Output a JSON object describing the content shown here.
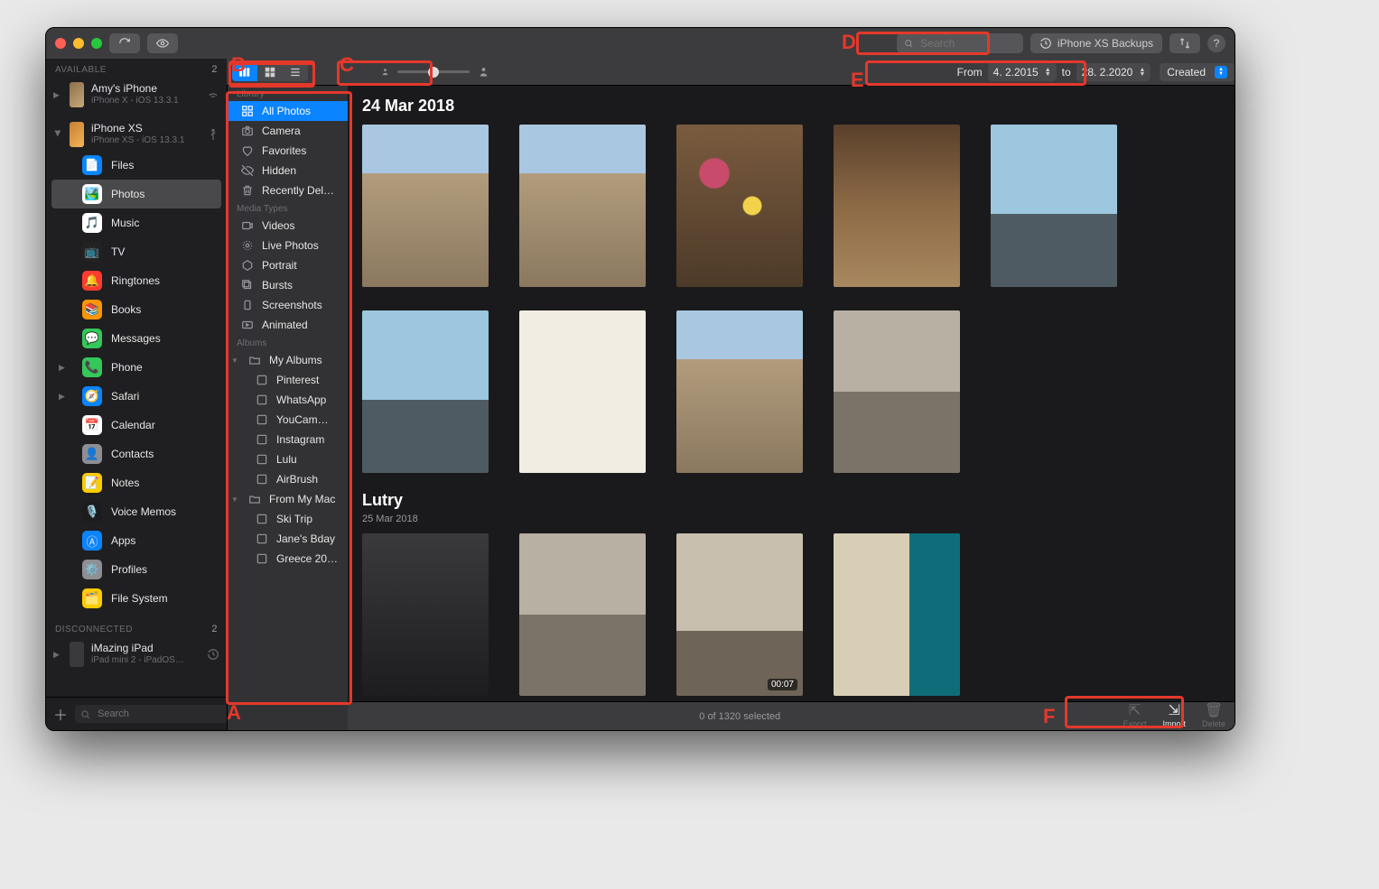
{
  "toolbar": {
    "search_placeholder": "Search",
    "backups_label": "iPhone XS Backups",
    "help_label": "?"
  },
  "sidebar": {
    "sections": {
      "available": {
        "label": "AVAILABLE",
        "count": "2"
      },
      "disconnected": {
        "label": "DISCONNECTED",
        "count": "2"
      }
    },
    "devices": [
      {
        "name": "Amy's iPhone",
        "sub": "iPhone X - iOS 13.3.1",
        "conn": "wifi",
        "expanded": false
      },
      {
        "name": "iPhone XS",
        "sub": "iPhone XS - iOS 13.3.1",
        "conn": "usb",
        "expanded": true
      }
    ],
    "device_disconnected": {
      "name": "iMazing iPad",
      "sub": "iPad mini 2 - iPadOS…"
    },
    "apps": [
      {
        "label": "Files",
        "color": "#0a84ff",
        "glyph": "📄"
      },
      {
        "label": "Photos",
        "color": "#ffffff",
        "glyph": "🏞️",
        "selected": true
      },
      {
        "label": "Music",
        "color": "#ffffff",
        "glyph": "🎵"
      },
      {
        "label": "TV",
        "color": "#222",
        "glyph": "📺"
      },
      {
        "label": "Ringtones",
        "color": "#ff3b30",
        "glyph": "🔔"
      },
      {
        "label": "Books",
        "color": "#ff9500",
        "glyph": "📚"
      },
      {
        "label": "Messages",
        "color": "#34c759",
        "glyph": "💬"
      },
      {
        "label": "Phone",
        "color": "#34c759",
        "glyph": "📞",
        "disclosure": true
      },
      {
        "label": "Safari",
        "color": "#0a84ff",
        "glyph": "🧭",
        "disclosure": true
      },
      {
        "label": "Calendar",
        "color": "#ffffff",
        "glyph": "📅"
      },
      {
        "label": "Contacts",
        "color": "#8e8e93",
        "glyph": "👤"
      },
      {
        "label": "Notes",
        "color": "#ffcc00",
        "glyph": "📝"
      },
      {
        "label": "Voice Memos",
        "color": "#1c1c1e",
        "glyph": "🎙️"
      },
      {
        "label": "Apps",
        "color": "#0a84ff",
        "glyph": "Ⓐ"
      },
      {
        "label": "Profiles",
        "color": "#8e8e93",
        "glyph": "⚙️"
      },
      {
        "label": "File System",
        "color": "#ffcc00",
        "glyph": "🗂️"
      }
    ],
    "footer_search_placeholder": "Search"
  },
  "library_panel": {
    "sections": [
      {
        "label": "Library",
        "items": [
          {
            "label": "All Photos",
            "icon": "grid",
            "selected": true
          },
          {
            "label": "Camera",
            "icon": "camera"
          },
          {
            "label": "Favorites",
            "icon": "heart"
          },
          {
            "label": "Hidden",
            "icon": "eye-off"
          },
          {
            "label": "Recently Del…",
            "icon": "trash"
          }
        ]
      },
      {
        "label": "Media Types",
        "items": [
          {
            "label": "Videos",
            "icon": "video"
          },
          {
            "label": "Live Photos",
            "icon": "live"
          },
          {
            "label": "Portrait",
            "icon": "portrait"
          },
          {
            "label": "Bursts",
            "icon": "burst"
          },
          {
            "label": "Screenshots",
            "icon": "screenshot"
          },
          {
            "label": "Animated",
            "icon": "gif"
          }
        ]
      },
      {
        "label": "Albums",
        "items": [
          {
            "label": "My Albums",
            "icon": "folder",
            "expanded": true,
            "children": [
              {
                "label": "Pinterest"
              },
              {
                "label": "WhatsApp"
              },
              {
                "label": "YouCam…"
              },
              {
                "label": "Instagram"
              },
              {
                "label": "Lulu"
              },
              {
                "label": "AirBrush"
              }
            ]
          },
          {
            "label": "From My Mac",
            "icon": "folder",
            "expanded": true,
            "children": [
              {
                "label": "Ski Trip",
                "icon": "album"
              },
              {
                "label": "Jane's Bday",
                "icon": "album"
              },
              {
                "label": "Greece 20…",
                "icon": "album"
              }
            ]
          }
        ]
      }
    ]
  },
  "filterbar": {
    "from_label": "From",
    "from_value": "4.  2.2015",
    "to_label": "to",
    "to_value": "28.  2.2020",
    "sort_label": "Created"
  },
  "content": {
    "groups": [
      {
        "title": "24 Mar 2018",
        "subtitle": "",
        "thumbs": [
          {
            "hint": "t-bld"
          },
          {
            "hint": "t-bld"
          },
          {
            "hint": "t-flowers"
          },
          {
            "hint": "t-warm"
          },
          {
            "hint": "t-sea"
          },
          {
            "hint": "t-sea"
          },
          {
            "hint": "t-paper"
          },
          {
            "hint": "t-bld"
          },
          {
            "hint": "t-street"
          }
        ]
      },
      {
        "title": "Lutry",
        "subtitle": "25 Mar 2018",
        "thumbs": [
          {
            "hint": "t-dark"
          },
          {
            "hint": "t-street"
          },
          {
            "hint": "t-cat",
            "badge": "00:07"
          },
          {
            "hint": "t-door"
          }
        ]
      }
    ]
  },
  "statusbar": {
    "selection": "0 of 1320 selected",
    "actions": [
      {
        "label": "Export"
      },
      {
        "label": "Import",
        "active": true
      },
      {
        "label": "Delete"
      }
    ]
  },
  "annotations": {
    "A": "A",
    "B": "B",
    "C": "C",
    "D": "D",
    "E": "E",
    "F": "F"
  }
}
